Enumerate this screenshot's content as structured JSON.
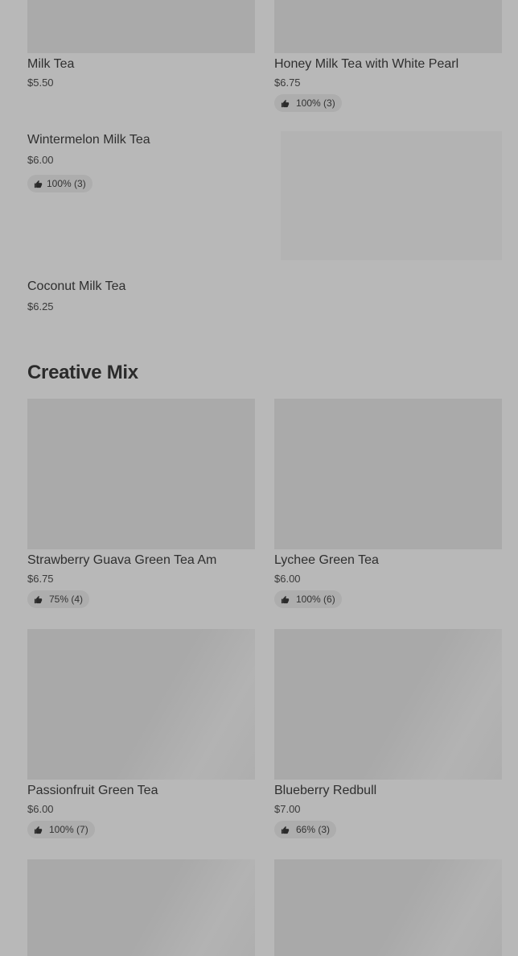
{
  "top_items": [
    {
      "name": "Milk Tea",
      "price": "$5.50"
    },
    {
      "name": "Honey Milk Tea with White Pearl",
      "price": "$6.75",
      "rating": "100% (3)"
    },
    {
      "name": "Wintermelon Milk Tea",
      "price": "$6.00",
      "rating": "100% (3)"
    },
    {
      "name": "Coconut Milk Tea",
      "price": "$6.25"
    }
  ],
  "creative_mix": {
    "title": "Creative Mix",
    "items": [
      {
        "name": "Strawberry Guava Green Tea Am",
        "price": "$6.75",
        "rating": "75% (4)"
      },
      {
        "name": "Lychee Green Tea",
        "price": "$6.00",
        "rating": "100% (6)"
      },
      {
        "name": "Passionfruit Green Tea",
        "price": "$6.00",
        "rating": "100% (7)"
      },
      {
        "name": "Blueberry Redbull",
        "price": "$7.00",
        "rating": "66% (3)"
      }
    ]
  },
  "icons": {
    "rating": "thumbs-up-icon"
  },
  "colors": {
    "background": "#b8b8b8",
    "image_placeholder": "#aaaaaa",
    "badge": "#adadad"
  }
}
